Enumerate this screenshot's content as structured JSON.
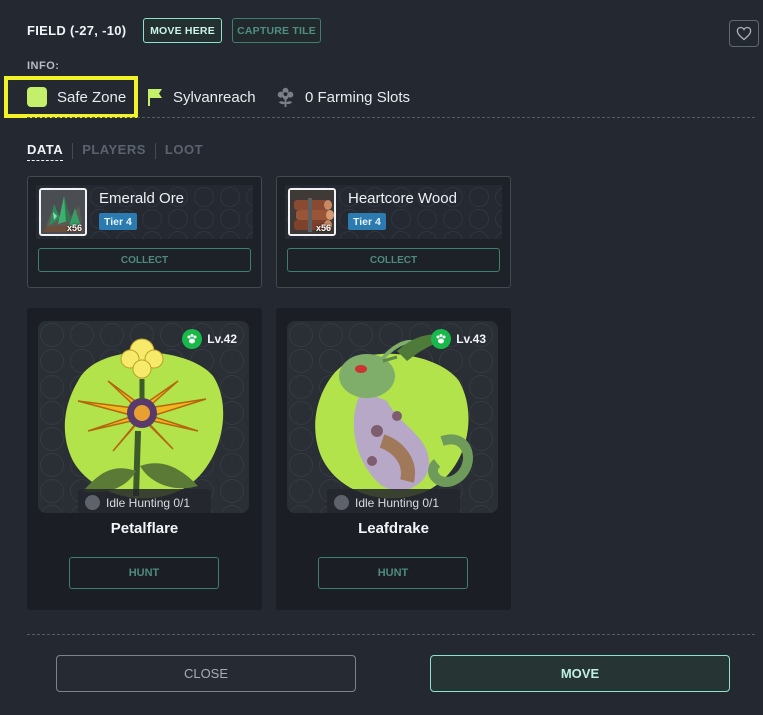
{
  "header": {
    "title": "FIELD (-27, -10)",
    "move_here_label": "MOVE HERE",
    "capture_tile_label": "CAPTURE TILE"
  },
  "info": {
    "label": "INFO:",
    "zone": "Safe Zone",
    "zone_color": "#c4ef6a",
    "region": "Sylvanreach",
    "farming_slots": "0 Farming Slots"
  },
  "tabs": [
    {
      "label": "DATA",
      "active": true
    },
    {
      "label": "PLAYERS",
      "active": false
    },
    {
      "label": "LOOT",
      "active": false
    }
  ],
  "resources": [
    {
      "name": "Emerald Ore",
      "tier": "Tier 4",
      "quantity": "x56",
      "action": "COLLECT",
      "icon": "emerald-ore-icon"
    },
    {
      "name": "Heartcore Wood",
      "tier": "Tier 4",
      "quantity": "x56",
      "action": "COLLECT",
      "icon": "wood-logs-icon"
    }
  ],
  "monsters": [
    {
      "name": "Petalflare",
      "level": "Lv.42",
      "status": "Idle Hunting 0/1",
      "action": "HUNT",
      "icon": "flower-monster-icon"
    },
    {
      "name": "Leafdrake",
      "level": "Lv.43",
      "status": "Idle Hunting 0/1",
      "action": "HUNT",
      "icon": "dragon-monster-icon"
    }
  ],
  "footer": {
    "close_label": "CLOSE",
    "move_label": "MOVE"
  },
  "colors": {
    "accent": "#8be3cf",
    "highlight": "#f2f229",
    "tier_badge": "#2b7bb0",
    "level_badge": "#19b84a"
  }
}
